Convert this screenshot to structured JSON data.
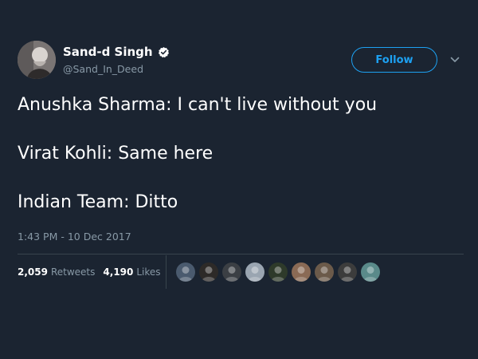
{
  "author": {
    "display_name": "Sand-d Singh",
    "handle": "@Sand_In_Deed",
    "verified": true
  },
  "header": {
    "follow_label": "Follow"
  },
  "tweet": {
    "lines": [
      "Anushka Sharma: I can't live without you",
      "Virat Kohli: Same here",
      "Indian Team: Ditto"
    ],
    "timestamp": "1:43 PM - 10 Dec 2017"
  },
  "stats": {
    "retweets_count": "2,059",
    "retweets_label": "Retweets",
    "likes_count": "4,190",
    "likes_label": "Likes"
  },
  "colors": {
    "background": "#1b2431",
    "accent": "#1da1f2",
    "secondary_text": "#8899a6",
    "border": "#38444d"
  },
  "likers": [
    {
      "name": "liker-avatar-1",
      "color": "#4a5a6e"
    },
    {
      "name": "liker-avatar-2",
      "color": "#2d2a28"
    },
    {
      "name": "liker-avatar-3",
      "color": "#3b3f44"
    },
    {
      "name": "liker-avatar-4",
      "color": "#9aa5b1"
    },
    {
      "name": "liker-avatar-5",
      "color": "#2e3a2a"
    },
    {
      "name": "liker-avatar-6",
      "color": "#8a6a55"
    },
    {
      "name": "liker-avatar-7",
      "color": "#6b5a4a"
    },
    {
      "name": "liker-avatar-8",
      "color": "#3c3c3c"
    },
    {
      "name": "liker-avatar-9",
      "color": "#5a8a8a"
    }
  ]
}
